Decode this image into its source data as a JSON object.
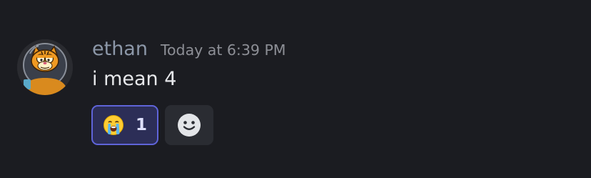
{
  "message": {
    "author": "ethan",
    "timestamp": "Today at 6:39 PM",
    "content": "i mean 4",
    "avatar_icon": "garfield-astronaut-avatar"
  },
  "reactions": [
    {
      "emoji_icon": "loudly-crying-face-emoji",
      "count": "1",
      "reacted_by_me": true
    }
  ],
  "add_reaction": {
    "icon": "smiley-face-icon"
  },
  "colors": {
    "background": "#1b1c21",
    "username": "#8c97a8",
    "timestamp": "#8d8f96",
    "text": "#e6e7ea",
    "reaction_border": "#5f64d9",
    "reaction_bg": "#2c2e57",
    "add_reaction_bg": "#2a2c32"
  }
}
